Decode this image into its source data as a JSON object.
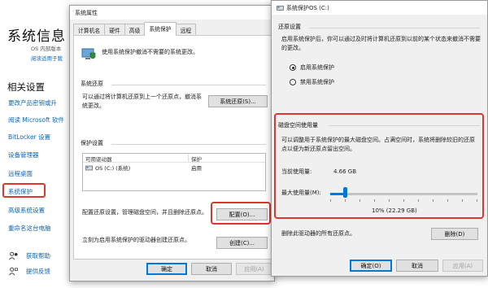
{
  "settings": {
    "title": "系统信息",
    "note_os": "OS 内部版本",
    "note_link": "阅读适用于我",
    "related_heading": "相关设置",
    "items": [
      "更改产品密钥或升",
      "阅读 Microsoft 软件",
      "BitLocker 设置",
      "设备管理器",
      "远程桌面",
      "系统保护",
      "高级系统设置",
      "重命名这台电脑"
    ],
    "bottom": [
      {
        "label": "获取帮助",
        "icon": "help-person-icon"
      },
      {
        "label": "提供反馈",
        "icon": "feedback-person-icon"
      }
    ]
  },
  "sysprops": {
    "title": "系统属性",
    "tabs": [
      "计算机名",
      "硬件",
      "高级",
      "系统保护",
      "远程"
    ],
    "active_tab": "系统保护",
    "intro": "使用系统保护撤消不需要的系统更改。",
    "restore_heading": "系统还原",
    "restore_text": "可以通过将计算机还原到上一个还原点，撤消系统更改。",
    "restore_button": "系统还原(S)...",
    "protect_heading": "保护设置",
    "list_headers": [
      "可用驱动器",
      "保护"
    ],
    "list_rows": [
      {
        "drive": "OS (C:) (系统)",
        "status": "启用"
      }
    ],
    "config_text": "配置还原设置，管理磁盘空间，并且删除还原点。",
    "config_button": "配置(O)...",
    "create_text": "立刻为启用系统保护的驱动器创建还原点。",
    "create_button": "创建(C)...",
    "ok": "确定",
    "cancel": "取消",
    "apply": "应用(A)"
  },
  "sysprot": {
    "title": "系统保护OS (C:)",
    "restore_heading": "还原设置",
    "restore_text": "启用系统保护后，你可以通过及时将计算机还原到以前的某个状态来撤消不需要的更改。",
    "radio_on": "启用系统保护",
    "radio_off": "禁用系统保护",
    "radio_selected": "启用系统保护",
    "disk_heading": "磁盘空间使用量",
    "disk_text": "可以调整用于系统保护的最大磁盘空间。占满空间时，系统将删除较旧的还原点以便为新还原点留出空间。",
    "current_label": "当前使用量:",
    "current_value": "4.66 GB",
    "max_label": "最大使用量(M):",
    "max_fraction": 0.1,
    "max_value": "10% (22.29 GB)",
    "delete_text": "删除此驱动器的所有还原点。",
    "delete_button": "删除(D)",
    "ok": "确定(O)",
    "cancel": "取消",
    "apply": "应用(A)",
    "accent": "#0078d7"
  },
  "highlight_color": "#e0342e"
}
